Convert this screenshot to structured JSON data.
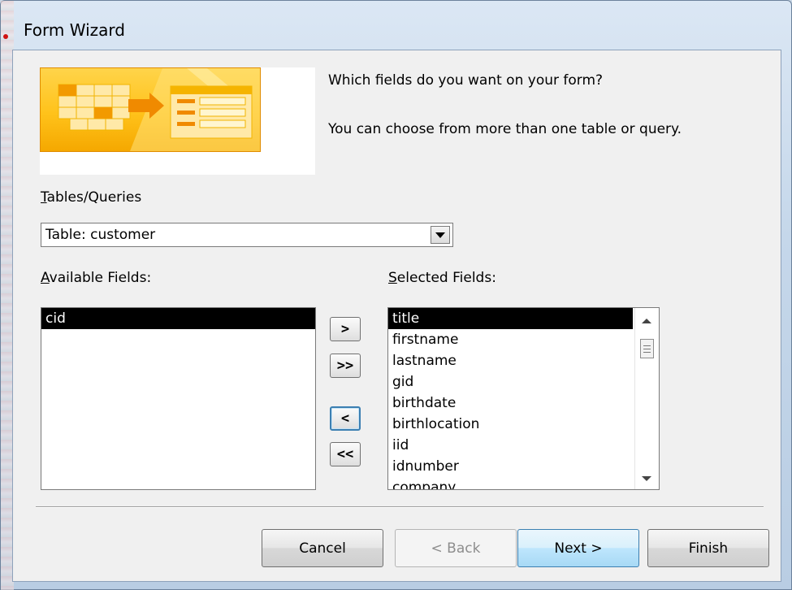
{
  "window": {
    "title": "Form Wizard"
  },
  "intro": {
    "line1": "Which fields do you want on your form?",
    "line2": "You can choose from more than one table or query."
  },
  "tables_queries": {
    "label_accel": "T",
    "label_rest": "ables/Queries",
    "selected": "Table: customer"
  },
  "available": {
    "label_accel": "A",
    "label_rest": "vailable Fields:",
    "items": [
      "cid"
    ]
  },
  "selected_fields": {
    "label_accel": "S",
    "label_rest": "elected Fields:",
    "items": [
      "title",
      "firstname",
      "lastname",
      "gid",
      "birthdate",
      "birthlocation",
      "iid",
      "idnumber",
      "company"
    ]
  },
  "move_buttons": {
    "add_one": ">",
    "add_all": ">>",
    "remove_one": "<",
    "remove_all": "<<"
  },
  "footer": {
    "cancel": "Cancel",
    "back": "< Back",
    "next": "Next >",
    "finish": "Finish"
  },
  "colors": {
    "banner_gold": "#ffc21a",
    "selection": "#000000",
    "default_button": "#bee6fd"
  }
}
